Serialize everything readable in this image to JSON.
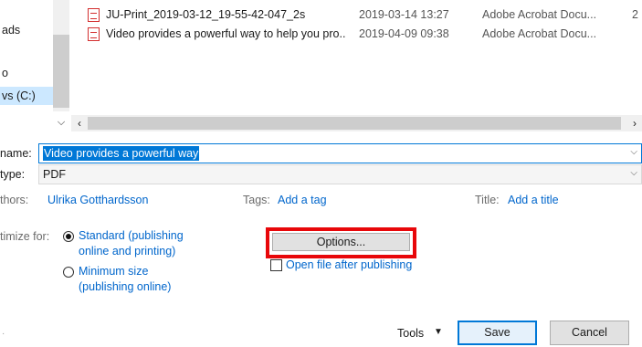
{
  "nav": {
    "items": [
      {
        "label": "ads"
      },
      {
        "label": "o"
      },
      {
        "label": "vs (C:)"
      }
    ]
  },
  "files": [
    {
      "name": "JU-Print_2019-03-12_19-55-42-047_2s",
      "date": "2019-03-14 13:27",
      "type": "Adobe Acrobat Docu...",
      "size": "2"
    },
    {
      "name": "Video provides a powerful way to help you pro...",
      "date": "2019-04-09 09:38",
      "type": "Adobe Acrobat Docu...",
      "size": ""
    }
  ],
  "form": {
    "filename_label": "name:",
    "filename_value": "Video provides a powerful way",
    "type_label": "type:",
    "type_value": "PDF",
    "authors_label": "thors:",
    "authors_value": "Ulrika Gotthardsson",
    "tags_label": "Tags:",
    "tags_value": "Add a tag",
    "title_label": "Title:",
    "title_value": "Add a title"
  },
  "optimize": {
    "label": "timize for:",
    "standard_line1": "Standard (publishing",
    "standard_line2": "online and printing)",
    "minimum_line1": "Minimum size",
    "minimum_line2": "(publishing online)",
    "selected": "standard"
  },
  "options": {
    "button_label": "Options...",
    "open_after_label": "Open file after publishing",
    "open_after_checked": false
  },
  "footer": {
    "tools_label": "Tools",
    "save_label": "Save",
    "cancel_label": "Cancel"
  },
  "colors": {
    "accent": "#0078d7",
    "link": "#0066cc",
    "highlight_box": "#e8070a"
  }
}
